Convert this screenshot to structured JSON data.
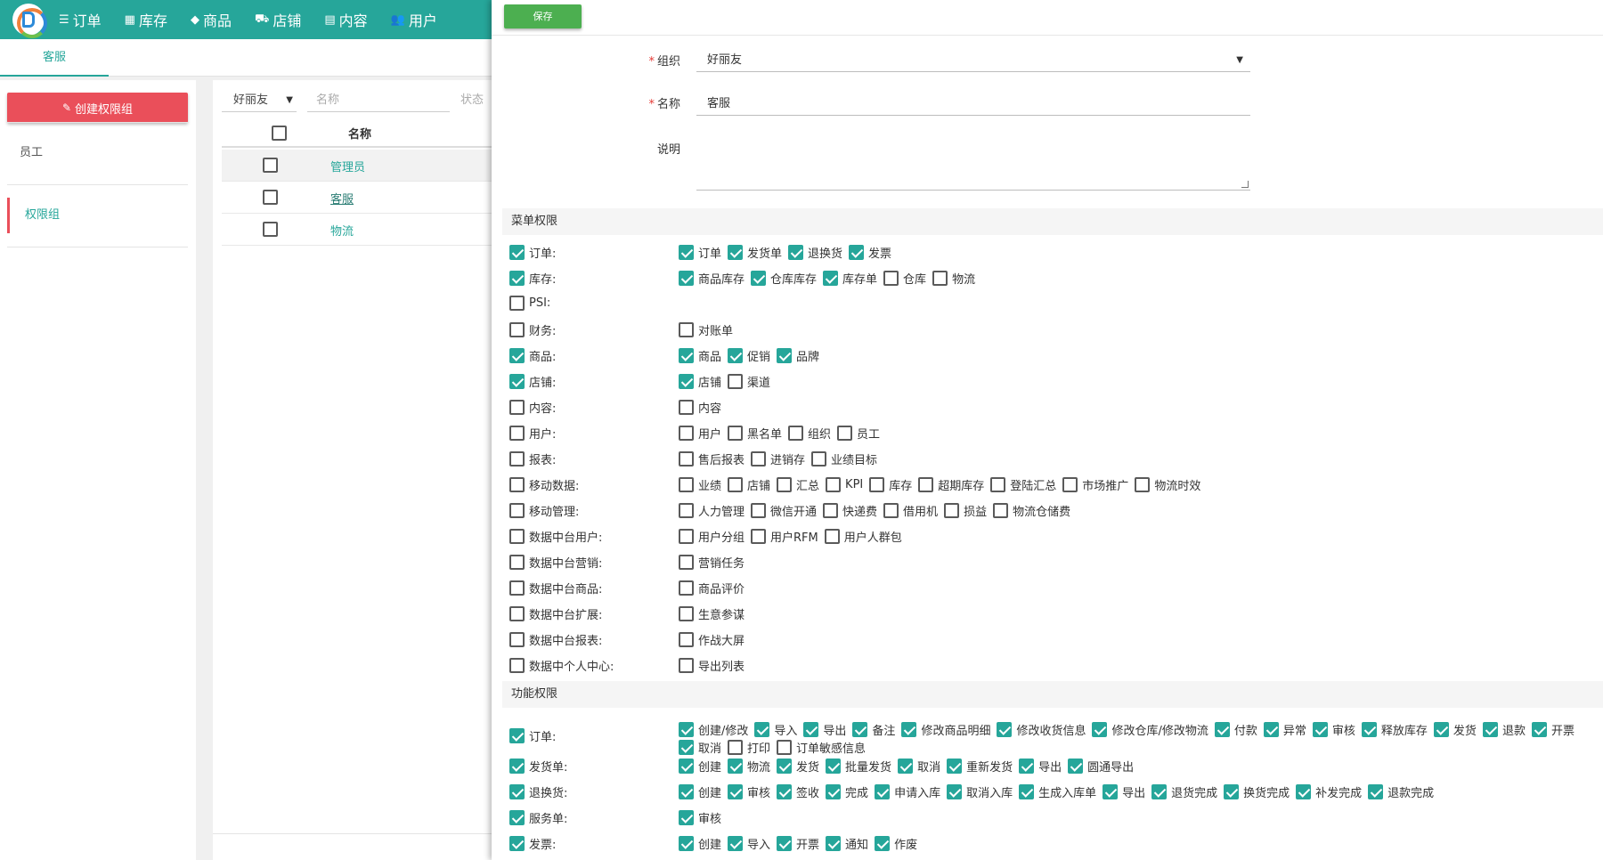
{
  "nav": {
    "items": [
      {
        "icon": "list-icon",
        "glyph": "☰",
        "label": "订单"
      },
      {
        "icon": "store-icon",
        "glyph": "▦",
        "label": "库存"
      },
      {
        "icon": "layers-icon",
        "glyph": "◆",
        "label": "商品"
      },
      {
        "icon": "shop-icon",
        "glyph": "⛟",
        "label": "店铺"
      },
      {
        "icon": "chat-icon",
        "glyph": "▤",
        "label": "内容"
      },
      {
        "icon": "users-icon",
        "glyph": "👥",
        "label": "用户"
      }
    ]
  },
  "subtab": {
    "label": "客服"
  },
  "sidebar": {
    "create_label": "创建权限组",
    "items": [
      {
        "label": "员工",
        "active": false
      },
      {
        "label": "权限组",
        "active": true
      }
    ]
  },
  "list": {
    "filter_org": "好丽友",
    "filter_name_placeholder": "名称",
    "filter_status_placeholder": "状态",
    "col_name": "名称",
    "rows": [
      {
        "name": "管理员"
      },
      {
        "name": "客服"
      },
      {
        "name": "物流"
      }
    ]
  },
  "form": {
    "save_label": "保存",
    "org_label": "组织",
    "org_value": "好丽友",
    "name_label": "名称",
    "name_value": "客服",
    "desc_label": "说明",
    "desc_value": ""
  },
  "menu_section": "菜单权限",
  "menu_perms": [
    {
      "label": "订单:",
      "checked": true,
      "options": [
        {
          "label": "订单",
          "checked": true
        },
        {
          "label": "发货单",
          "checked": true
        },
        {
          "label": "退换货",
          "checked": true
        },
        {
          "label": "发票",
          "checked": true
        }
      ]
    },
    {
      "label": "库存:",
      "checked": true,
      "options": [
        {
          "label": "商品库存",
          "checked": true
        },
        {
          "label": "仓库库存",
          "checked": true
        },
        {
          "label": "库存单",
          "checked": true
        },
        {
          "label": "仓库",
          "checked": false
        },
        {
          "label": "物流",
          "checked": false
        }
      ]
    },
    {
      "label": "PSI:",
      "checked": false,
      "options": []
    },
    {
      "label": "财务:",
      "checked": false,
      "options": [
        {
          "label": "对账单",
          "checked": false
        }
      ]
    },
    {
      "label": "商品:",
      "checked": true,
      "options": [
        {
          "label": "商品",
          "checked": true
        },
        {
          "label": "促销",
          "checked": true
        },
        {
          "label": "品牌",
          "checked": true
        }
      ]
    },
    {
      "label": "店铺:",
      "checked": true,
      "options": [
        {
          "label": "店铺",
          "checked": true
        },
        {
          "label": "渠道",
          "checked": false
        }
      ]
    },
    {
      "label": "内容:",
      "checked": false,
      "options": [
        {
          "label": "内容",
          "checked": false
        }
      ]
    },
    {
      "label": "用户:",
      "checked": false,
      "options": [
        {
          "label": "用户",
          "checked": false
        },
        {
          "label": "黑名单",
          "checked": false
        },
        {
          "label": "组织",
          "checked": false
        },
        {
          "label": "员工",
          "checked": false
        }
      ]
    },
    {
      "label": "报表:",
      "checked": false,
      "options": [
        {
          "label": "售后报表",
          "checked": false
        },
        {
          "label": "进销存",
          "checked": false
        },
        {
          "label": "业绩目标",
          "checked": false
        }
      ]
    },
    {
      "label": "移动数据:",
      "checked": false,
      "options": [
        {
          "label": "业绩",
          "checked": false
        },
        {
          "label": "店铺",
          "checked": false
        },
        {
          "label": "汇总",
          "checked": false
        },
        {
          "label": "KPI",
          "checked": false
        },
        {
          "label": "库存",
          "checked": false
        },
        {
          "label": "超期库存",
          "checked": false
        },
        {
          "label": "登陆汇总",
          "checked": false
        },
        {
          "label": "市场推广",
          "checked": false
        },
        {
          "label": "物流时效",
          "checked": false
        }
      ]
    },
    {
      "label": "移动管理:",
      "checked": false,
      "options": [
        {
          "label": "人力管理",
          "checked": false
        },
        {
          "label": "微信开通",
          "checked": false
        },
        {
          "label": "快递费",
          "checked": false
        },
        {
          "label": "借用机",
          "checked": false
        },
        {
          "label": "损益",
          "checked": false
        },
        {
          "label": "物流仓储费",
          "checked": false
        }
      ]
    },
    {
      "label": "数据中台用户:",
      "checked": false,
      "options": [
        {
          "label": "用户分组",
          "checked": false
        },
        {
          "label": "用户RFM",
          "checked": false
        },
        {
          "label": "用户人群包",
          "checked": false
        }
      ]
    },
    {
      "label": "数据中台营销:",
      "checked": false,
      "options": [
        {
          "label": "营销任务",
          "checked": false
        }
      ]
    },
    {
      "label": "数据中台商品:",
      "checked": false,
      "options": [
        {
          "label": "商品评价",
          "checked": false
        }
      ]
    },
    {
      "label": "数据中台扩展:",
      "checked": false,
      "options": [
        {
          "label": "生意参谋",
          "checked": false
        }
      ]
    },
    {
      "label": "数据中台报表:",
      "checked": false,
      "options": [
        {
          "label": "作战大屏",
          "checked": false
        }
      ]
    },
    {
      "label": "数据中个人中心:",
      "checked": false,
      "options": [
        {
          "label": "导出列表",
          "checked": false
        }
      ]
    }
  ],
  "func_section": "功能权限",
  "func_perms": [
    {
      "label": "订单:",
      "checked": true,
      "options": [
        {
          "label": "创建/修改",
          "checked": true
        },
        {
          "label": "导入",
          "checked": true
        },
        {
          "label": "导出",
          "checked": true
        },
        {
          "label": "备注",
          "checked": true
        },
        {
          "label": "修改商品明细",
          "checked": true
        },
        {
          "label": "修改收货信息",
          "checked": true
        },
        {
          "label": "修改仓库/修改物流",
          "checked": true
        },
        {
          "label": "付款",
          "checked": true
        },
        {
          "label": "异常",
          "checked": true
        },
        {
          "label": "审核",
          "checked": true
        },
        {
          "label": "释放库存",
          "checked": true
        },
        {
          "label": "发货",
          "checked": true
        },
        {
          "label": "退款",
          "checked": true
        },
        {
          "label": "开票",
          "checked": true
        },
        {
          "label": "取消",
          "checked": true
        },
        {
          "label": "打印",
          "checked": false
        },
        {
          "label": "订单敏感信息",
          "checked": false
        }
      ]
    },
    {
      "label": "发货单:",
      "checked": true,
      "options": [
        {
          "label": "创建",
          "checked": true
        },
        {
          "label": "物流",
          "checked": true
        },
        {
          "label": "发货",
          "checked": true
        },
        {
          "label": "批量发货",
          "checked": true
        },
        {
          "label": "取消",
          "checked": true
        },
        {
          "label": "重新发货",
          "checked": true
        },
        {
          "label": "导出",
          "checked": true
        },
        {
          "label": "圆通导出",
          "checked": true
        }
      ]
    },
    {
      "label": "退换货:",
      "checked": true,
      "options": [
        {
          "label": "创建",
          "checked": true
        },
        {
          "label": "审核",
          "checked": true
        },
        {
          "label": "签收",
          "checked": true
        },
        {
          "label": "完成",
          "checked": true
        },
        {
          "label": "申请入库",
          "checked": true
        },
        {
          "label": "取消入库",
          "checked": true
        },
        {
          "label": "生成入库单",
          "checked": true
        },
        {
          "label": "导出",
          "checked": true
        },
        {
          "label": "退货完成",
          "checked": true
        },
        {
          "label": "换货完成",
          "checked": true
        },
        {
          "label": "补发完成",
          "checked": true
        },
        {
          "label": "退款完成",
          "checked": true
        }
      ]
    },
    {
      "label": "服务单:",
      "checked": true,
      "options": [
        {
          "label": "审核",
          "checked": true
        }
      ]
    },
    {
      "label": "发票:",
      "checked": true,
      "options": [
        {
          "label": "创建",
          "checked": true
        },
        {
          "label": "导入",
          "checked": true
        },
        {
          "label": "开票",
          "checked": true
        },
        {
          "label": "通知",
          "checked": true
        },
        {
          "label": "作废",
          "checked": true
        }
      ]
    }
  ]
}
